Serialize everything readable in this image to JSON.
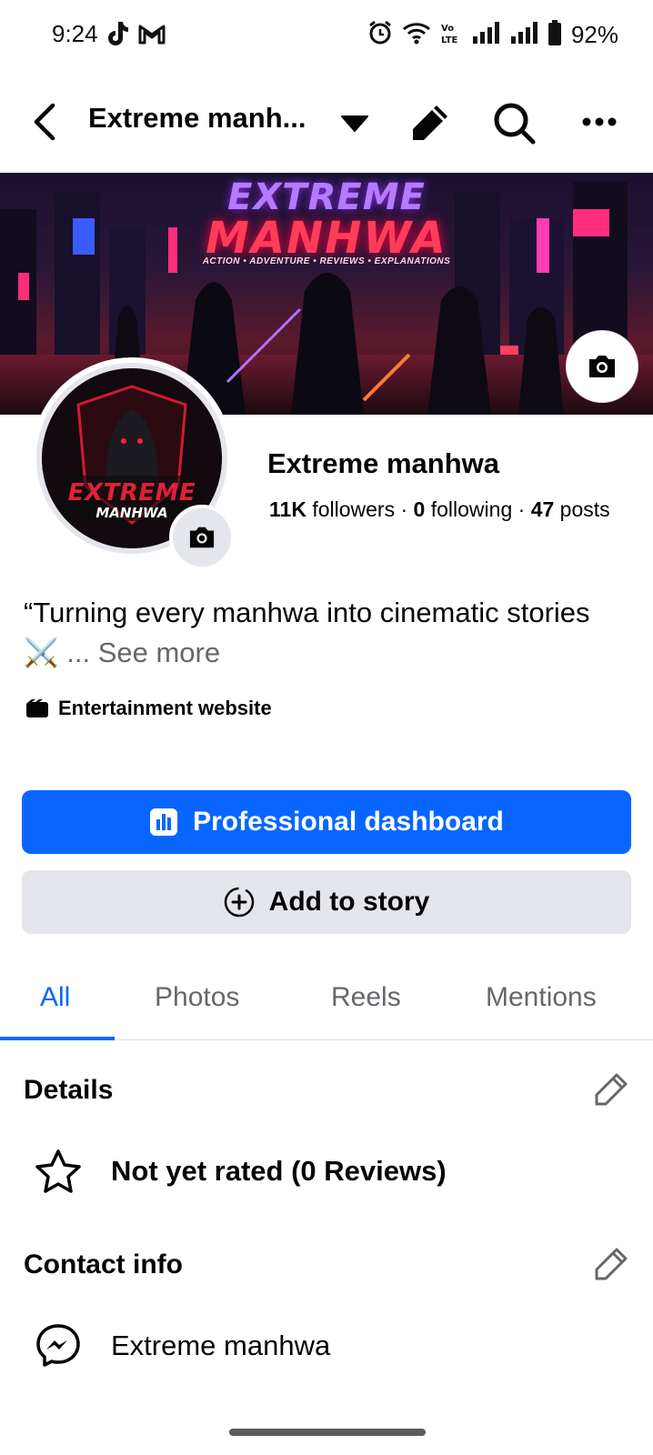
{
  "status_bar": {
    "time": "9:24",
    "battery": "92%",
    "left_icons": [
      "tiktok-icon",
      "gmail-icon"
    ],
    "right_icons": [
      "alarm-icon",
      "wifi-icon",
      "volte-icon",
      "signal-icon",
      "signal-icon",
      "battery-icon"
    ]
  },
  "header": {
    "title": "Extreme manh...",
    "icons": [
      "back-arrow-icon",
      "caret-down-icon",
      "pencil-icon",
      "search-icon",
      "more-icon"
    ]
  },
  "cover": {
    "title_line1": "EXTREME",
    "title_line2": "MANHWA",
    "subtitle": "ACTION • ADVENTURE • REVIEWS • EXPLANATIONS"
  },
  "avatar": {
    "logo_line1": "EXTREME",
    "logo_line2": "MANHWA"
  },
  "profile": {
    "name": "Extreme manhwa",
    "followers_count": "11K",
    "followers_label": "followers",
    "following_count": "0",
    "following_label": "following",
    "posts_count": "47",
    "posts_label": "posts",
    "separator": " · ",
    "bio": "“Turning every manhwa into cinematic stories ⚔️",
    "bio_ellipsis": "...",
    "see_more": "See more",
    "category": "Entertainment website"
  },
  "buttons": {
    "primary_label": "Professional dashboard",
    "secondary_label": "Add to story"
  },
  "tabs": [
    {
      "label": "All",
      "active": true
    },
    {
      "label": "Photos",
      "active": false
    },
    {
      "label": "Reels",
      "active": false
    },
    {
      "label": "Mentions",
      "active": false
    }
  ],
  "details": {
    "title": "Details",
    "rating": "Not yet rated (0 Reviews)"
  },
  "contact": {
    "title": "Contact info",
    "messenger": "Extreme manhwa"
  },
  "colors": {
    "accent": "#0866ff",
    "secondary_button": "#e4e6eb",
    "muted_text": "#65676b"
  }
}
